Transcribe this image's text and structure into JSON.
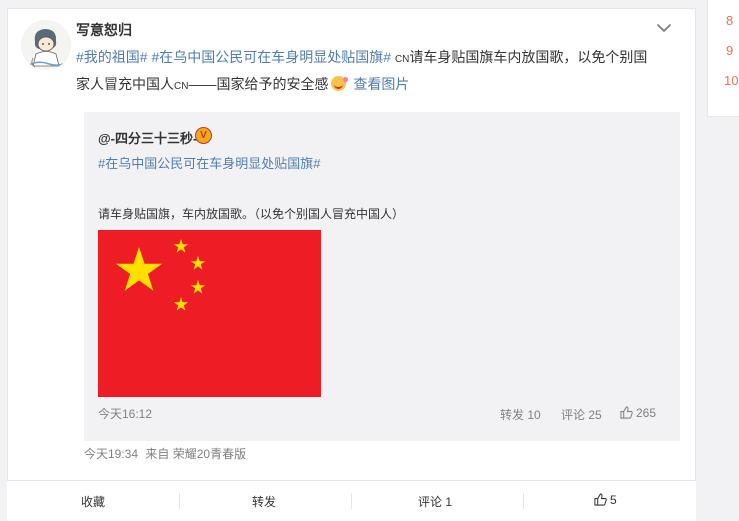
{
  "right_panel": {
    "ranks": [
      "8",
      "9",
      "10"
    ]
  },
  "post": {
    "username": "写意恕归",
    "topic1": "#我的祖国#",
    "topic2": "#在乌中国公民可在车身明显处贴国旗#",
    "cn_tag1": "CN",
    "text1": "请车身贴国旗车内放国歌，以免个别国",
    "text2": "家人冒充中国人",
    "cn_tag2": "CN",
    "text3": "——国家给予的安全感",
    "emoji": "heart-eyes-emoji",
    "view_image": "查看图片",
    "meta_time": "今天19:34",
    "meta_from": "来自",
    "meta_device": "荣耀20青春版"
  },
  "quote": {
    "username": "@-四分三十三秒-",
    "verify_badge": "V",
    "topic": "#在乌中国公民可在车身明显处贴国旗#",
    "text": "请车身贴国旗，车内放国歌。（以免个别国人冒充中国人）",
    "time": "今天16:12",
    "repost": "转发 10",
    "comment": "评论 25",
    "likes": "265",
    "flag_colors": {
      "field": "#ee1c25",
      "stars": "#ffde00"
    }
  },
  "actions": {
    "favorite": "收藏",
    "repost": "转发",
    "comment": "评论 1",
    "likes": "5"
  },
  "colors": {
    "link": "#507daf",
    "rank": "#eb7350",
    "meta": "#808080"
  }
}
